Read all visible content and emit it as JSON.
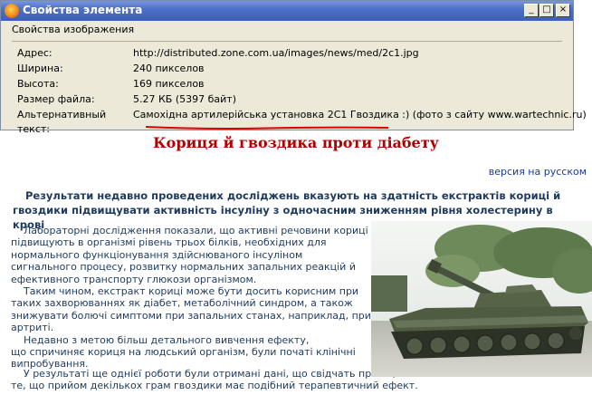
{
  "dialog": {
    "title": "Свойства элемента",
    "buttons": {
      "minimize": "_",
      "maximize": "□",
      "close": "×"
    },
    "tab": "Свойства изображения",
    "fields": [
      {
        "label": "Адрес:",
        "value": "http://distributed.zone.com.ua/images/news/med/2c1.jpg"
      },
      {
        "label": "Ширина:",
        "value": "240 пикселов"
      },
      {
        "label": "Высота:",
        "value": "169 пикселов"
      },
      {
        "label": "Размер файла:",
        "value": "5.27 КБ (5397 байт)"
      }
    ],
    "alt": {
      "label": "Альтернативный текст:",
      "value_main": "Самохідна артилерійська установка 2С1 Гвоздика :)",
      "value_rest": " (фото з сайту www.wartechnic.ru)"
    }
  },
  "page": {
    "title": "Кориця й гвоздика проти діабету",
    "lang_link": "версия на русском",
    "lead": "Результати недавно проведених досліджень вказують на здатність екстрактів кориці й гвоздики підвищувати активність інсуліну з одночасним зниженням рівня холестерину в крові",
    "paragraphs": [
      "Лабораторні дослідження показали, що активні речовини кориці підвищують в організмі рівень трьох білків, необхідних для нормального функціонування здійснюваного інсуліном сигнального процесу, розвитку нормальних запальних реакцій й ефективного транспорту глюкози організмом.",
      "Таким чином, екстракт кориці може бути досить корисним при таких захворюваннях як діабет, метаболічний синдром, а також знижувати болючі симптоми при запальних станах, наприклад, при артриті.",
      "Недавно з метою більш детального вивчення ефекту,",
      "що спричиняє кориця на людський організм, були початі клінічні випробування."
    ],
    "wide_lines": [
      "У результаті ще однієї роботи були отримані дані, що свідчать про те,",
      "те, що прийом декількох грам гвоздики має подібний терапевтичний ефект."
    ]
  },
  "colors": {
    "title_red": "#b00000",
    "text_blue": "#1f3a5e",
    "link_blue": "#1a3a9a",
    "underline_red": "#e00000"
  }
}
